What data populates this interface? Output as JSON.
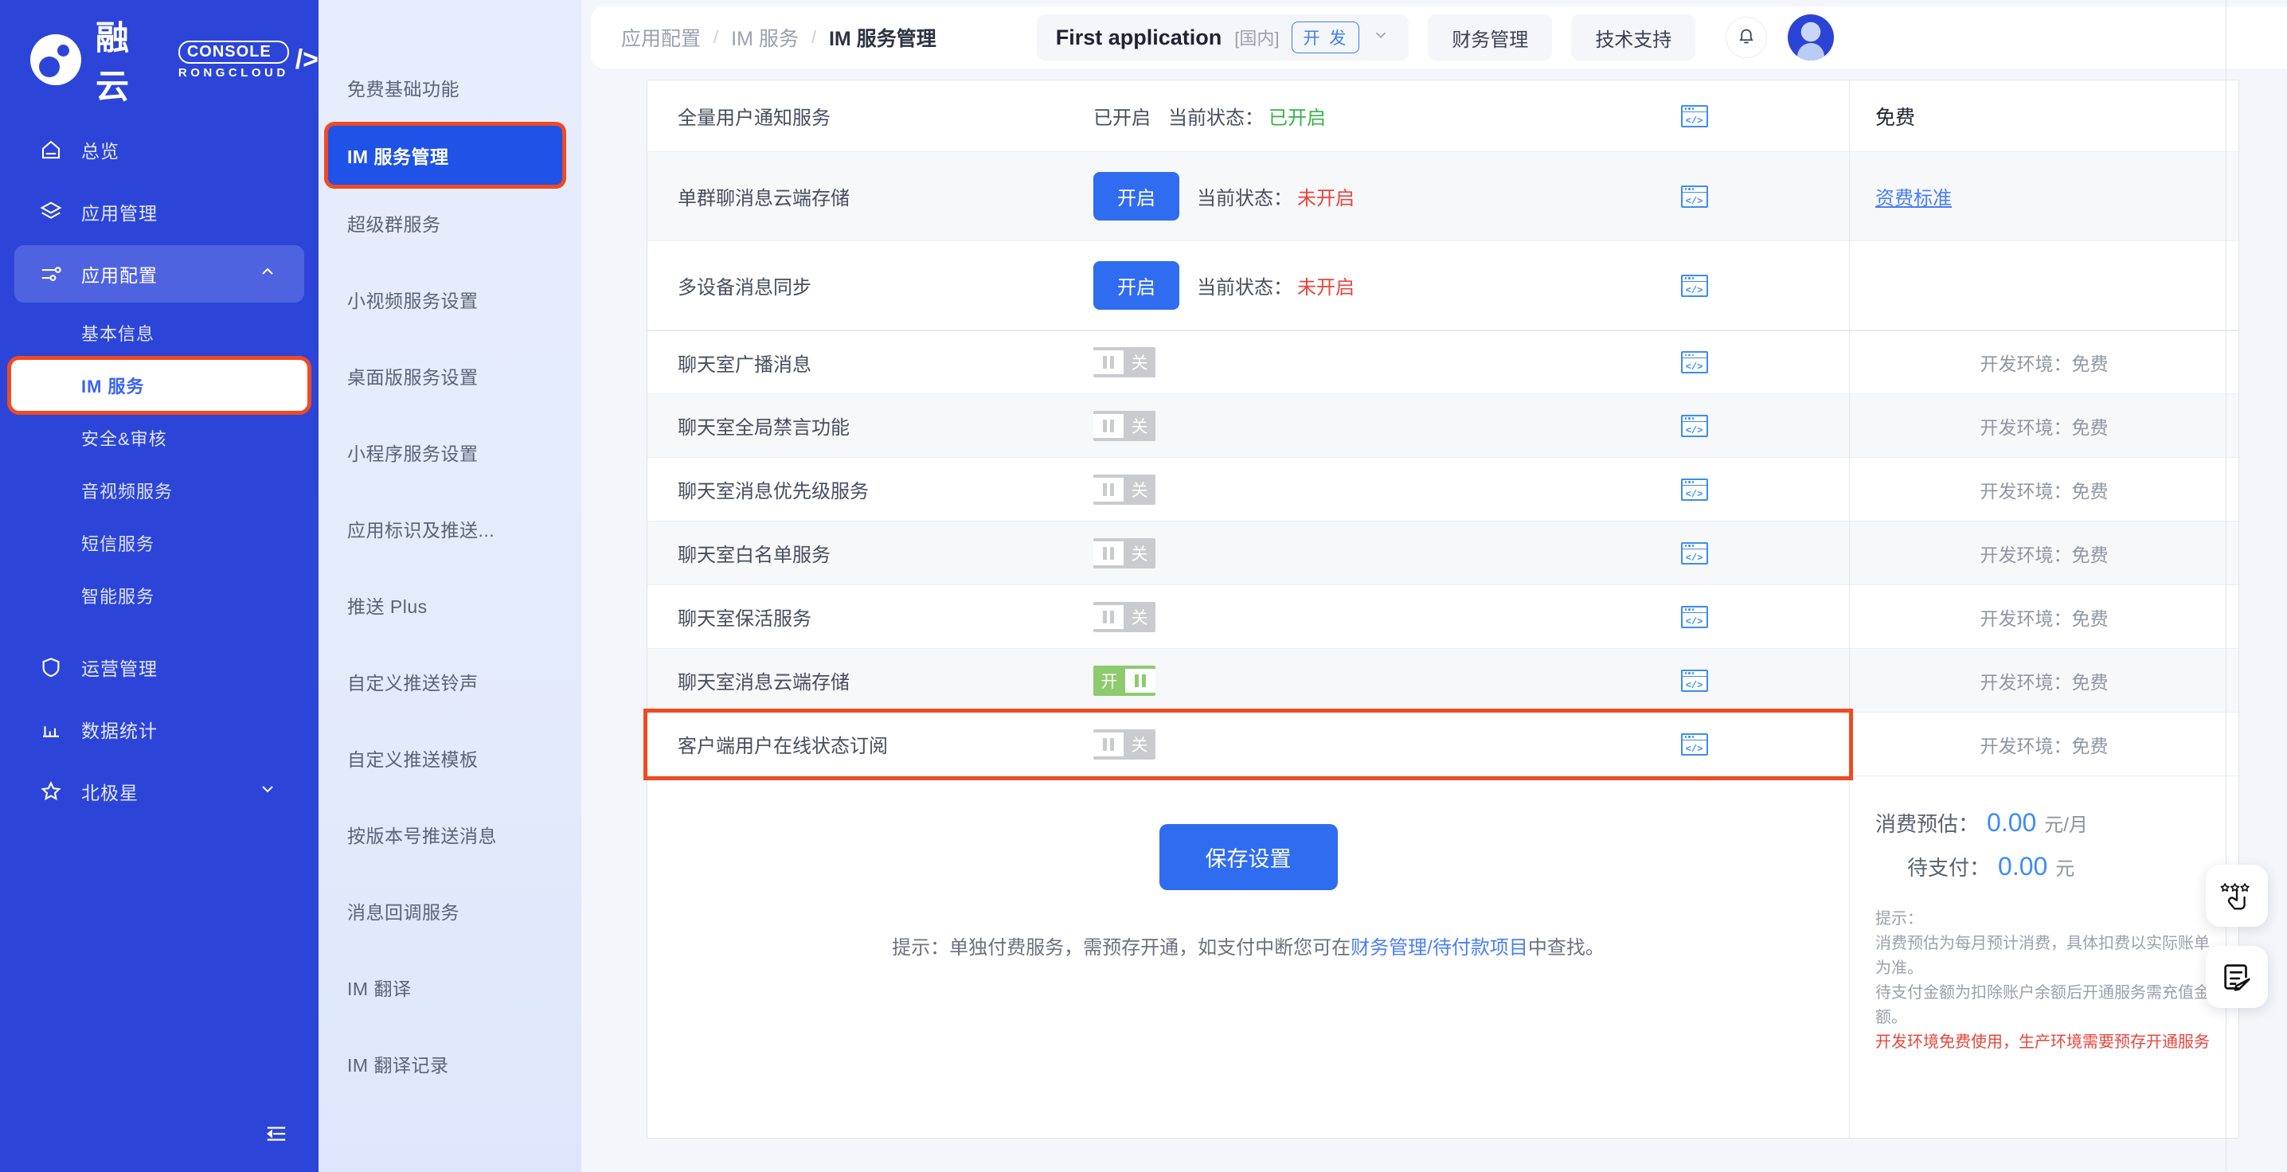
{
  "brand": {
    "name_cn": "融云",
    "console_label": "CONSOLE",
    "rongcloud_label": "RONGCLOUD",
    "mark_icon": "rongcloud-logo-icon"
  },
  "sidebar": {
    "items": [
      {
        "label": "总览",
        "icon": "home-icon",
        "active": false
      },
      {
        "label": "应用管理",
        "icon": "layers-icon",
        "active": false
      },
      {
        "label": "应用配置",
        "icon": "sliders-icon",
        "active": true,
        "expanded": true
      },
      {
        "label": "运营管理",
        "icon": "shield-icon",
        "active": false
      },
      {
        "label": "数据统计",
        "icon": "bar-chart-icon",
        "active": false
      },
      {
        "label": "北极星",
        "icon": "star-icon",
        "active": false,
        "expanded": false
      }
    ],
    "sub_items": [
      {
        "label": "基本信息",
        "selected": false
      },
      {
        "label": "IM 服务",
        "selected": true
      },
      {
        "label": "安全&审核",
        "selected": false
      },
      {
        "label": "音视频服务",
        "selected": false
      },
      {
        "label": "短信服务",
        "selected": false
      },
      {
        "label": "智能服务",
        "selected": false
      }
    ],
    "collapse_icon": "collapse-sidebar-icon"
  },
  "submenu": {
    "items": [
      {
        "label": "免费基础功能",
        "active": false
      },
      {
        "label": "IM 服务管理",
        "active": true
      },
      {
        "label": "超级群服务",
        "active": false
      },
      {
        "label": "小视频服务设置",
        "active": false
      },
      {
        "label": "桌面版服务设置",
        "active": false
      },
      {
        "label": "小程序服务设置",
        "active": false
      },
      {
        "label": "应用标识及推送...",
        "active": false
      },
      {
        "label": "推送 Plus",
        "active": false
      },
      {
        "label": "自定义推送铃声",
        "active": false
      },
      {
        "label": "自定义推送模板",
        "active": false
      },
      {
        "label": "按版本号推送消息",
        "active": false
      },
      {
        "label": "消息回调服务",
        "active": false
      },
      {
        "label": "IM 翻译",
        "active": false
      },
      {
        "label": "IM 翻译记录",
        "active": false
      }
    ]
  },
  "topbar": {
    "breadcrumb": [
      "应用配置",
      "IM 服务",
      "IM 服务管理"
    ],
    "separator": "/",
    "app_name": "First application",
    "region": "[国内]",
    "env_tag": "开 发",
    "chevron_icon": "chevron-down-icon",
    "finance_button": "财务管理",
    "support_button": "技术支持",
    "bell_icon": "bell-icon",
    "avatar_icon": "user-avatar-icon"
  },
  "table": {
    "rows": [
      {
        "name": "全量用户通知服务",
        "control_type": "text",
        "control_text": "已开启",
        "status_label": "当前状态：",
        "status_value": "已开启",
        "status_state": "on",
        "api_icon": "api-doc-icon",
        "price": "免费",
        "price_kind": "free-header",
        "shade": false,
        "size": "first"
      },
      {
        "name": "单群聊消息云端存储",
        "control_type": "button",
        "control_text": "开启",
        "status_label": "当前状态：",
        "status_value": "未开启",
        "status_state": "off",
        "api_icon": "api-doc-icon",
        "price": "资费标准",
        "price_kind": "link",
        "shade": true,
        "size": "tall"
      },
      {
        "name": "多设备消息同步",
        "control_type": "button",
        "control_text": "开启",
        "status_label": "当前状态：",
        "status_value": "未开启",
        "status_state": "off",
        "api_icon": "api-doc-icon",
        "price": "",
        "price_kind": "blank",
        "shade": false,
        "size": "tall"
      },
      {
        "name": "聊天室广播消息",
        "control_type": "switch",
        "switch_on": false,
        "switch_on_text": "开",
        "switch_off_text": "关",
        "api_icon": "api-doc-icon",
        "price": "开发环境：免费",
        "price_kind": "text",
        "shade": false,
        "size": "normal"
      },
      {
        "name": "聊天室全局禁言功能",
        "control_type": "switch",
        "switch_on": false,
        "switch_on_text": "开",
        "switch_off_text": "关",
        "api_icon": "api-doc-icon",
        "price": "开发环境：免费",
        "price_kind": "text",
        "shade": true,
        "size": "normal"
      },
      {
        "name": "聊天室消息优先级服务",
        "control_type": "switch",
        "switch_on": false,
        "switch_on_text": "开",
        "switch_off_text": "关",
        "api_icon": "api-doc-icon",
        "price": "开发环境：免费",
        "price_kind": "text",
        "shade": false,
        "size": "normal"
      },
      {
        "name": "聊天室白名单服务",
        "control_type": "switch",
        "switch_on": false,
        "switch_on_text": "开",
        "switch_off_text": "关",
        "api_icon": "api-doc-icon",
        "price": "开发环境：免费",
        "price_kind": "text",
        "shade": true,
        "size": "normal"
      },
      {
        "name": "聊天室保活服务",
        "control_type": "switch",
        "switch_on": false,
        "switch_on_text": "开",
        "switch_off_text": "关",
        "api_icon": "api-doc-icon",
        "price": "开发环境：免费",
        "price_kind": "text",
        "shade": false,
        "size": "normal"
      },
      {
        "name": "聊天室消息云端存储",
        "control_type": "switch",
        "switch_on": true,
        "switch_on_text": "开",
        "switch_off_text": "关",
        "api_icon": "api-doc-icon",
        "price": "开发环境：免费",
        "price_kind": "text",
        "shade": true,
        "size": "normal"
      },
      {
        "name": "客户端用户在线状态订阅",
        "control_type": "switch",
        "switch_on": false,
        "switch_on_text": "开",
        "switch_off_text": "关",
        "api_icon": "api-doc-icon",
        "price": "开发环境：免费",
        "price_kind": "text",
        "shade": false,
        "size": "normal",
        "highlighted": true
      }
    ]
  },
  "footer": {
    "save_label": "保存设置",
    "hint_prefix": "提示：单独付费服务，需预存开通，如支付中断您可在",
    "hint_link": "财务管理/待付款项目",
    "hint_suffix": "中查找。"
  },
  "summary": {
    "estimate_label": "消费预估：",
    "estimate_value": "0.00",
    "estimate_unit": "元/月",
    "payable_label": "待支付：",
    "payable_value": "0.00",
    "payable_unit": "元",
    "notes_title": "提示：",
    "note_1": "消费预估为每月预计消费，具体扣费以实际账单为准。",
    "note_2": "待支付金额为扣除账户余额后开通服务需充值金额。",
    "note_warn": "开发环境免费使用，生产环境需要预存开通服务"
  },
  "fabs": [
    {
      "icon": "rate-stars-hand-icon"
    },
    {
      "icon": "feedback-edit-icon"
    }
  ],
  "colors": {
    "brand_blue": "#2c45d8",
    "accent_blue": "#2f6cf0",
    "highlight_red": "#f04a23",
    "status_on_green": "#35b14a",
    "status_off_red": "#e8453c",
    "switch_on_green": "#8dcb6f",
    "link_blue": "#4a7df8"
  }
}
